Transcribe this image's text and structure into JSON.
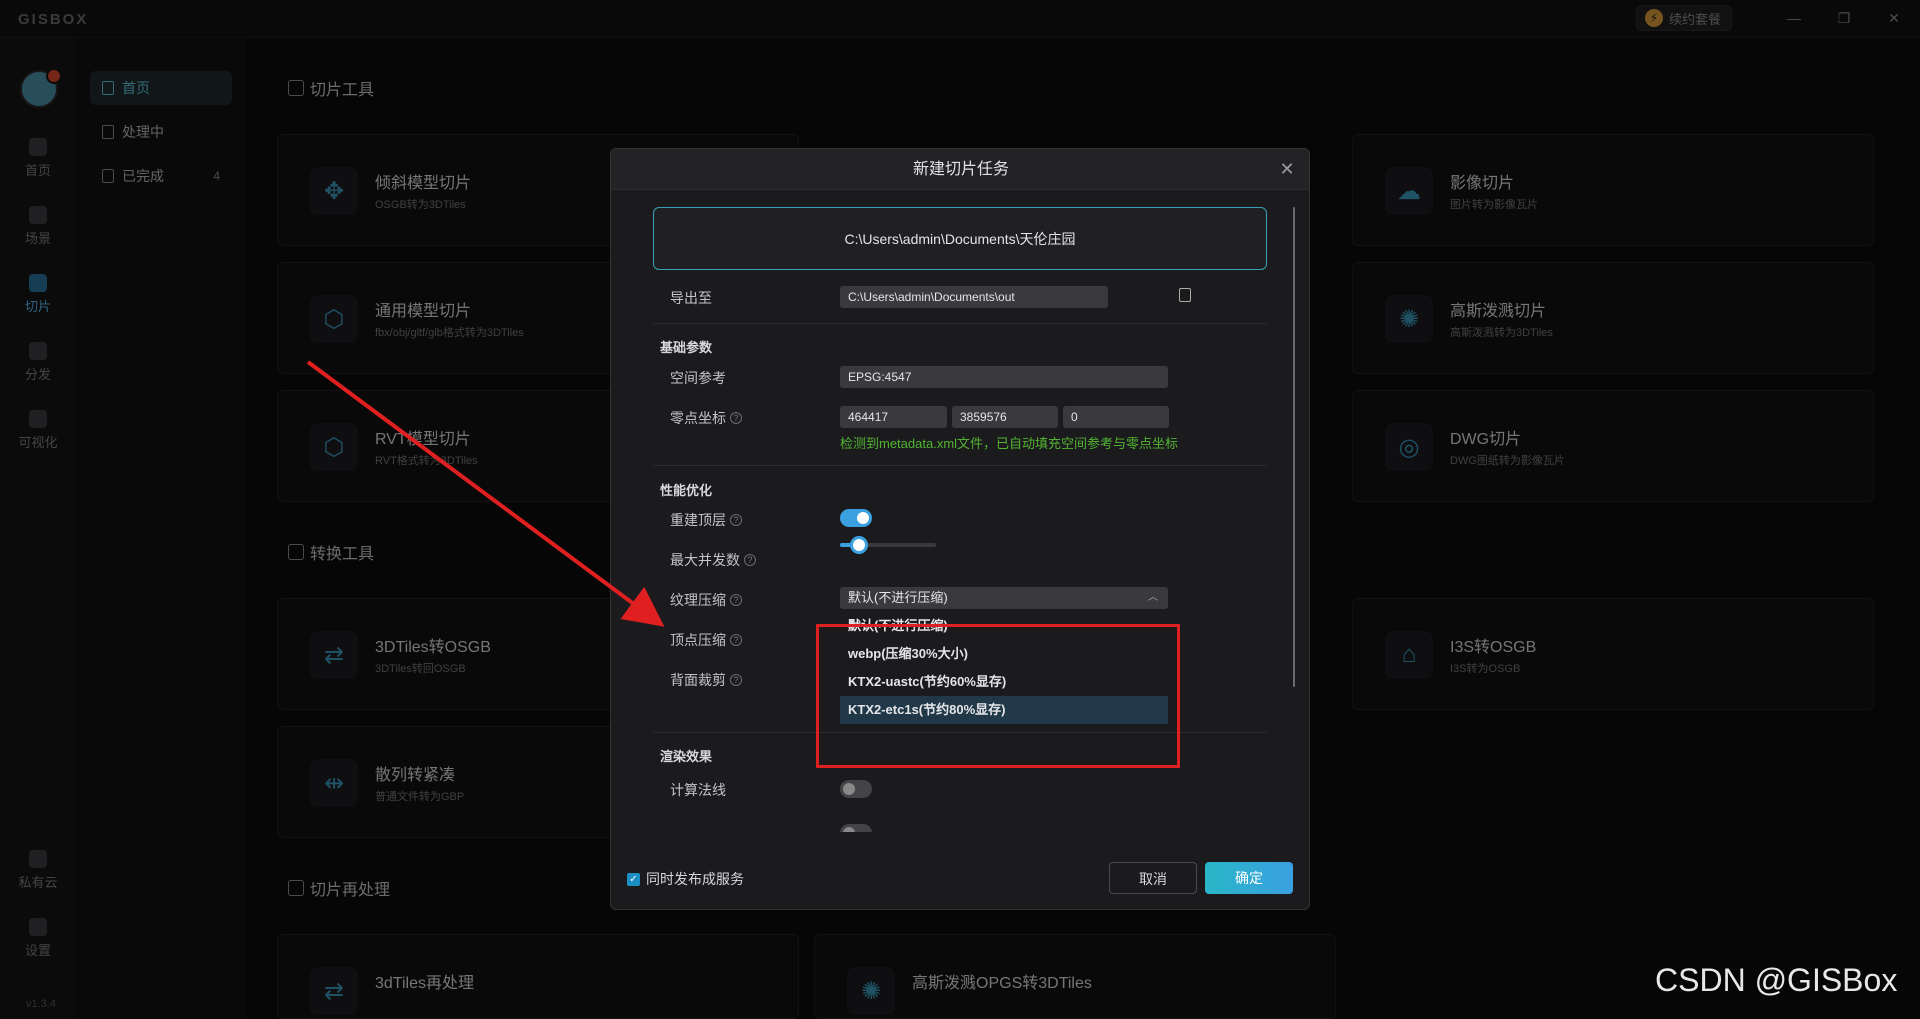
{
  "app": {
    "logo": "GISBOX",
    "renew_label": "续约套餐"
  },
  "rail": {
    "items": [
      {
        "label": "首页"
      },
      {
        "label": "场景"
      },
      {
        "label": "切片"
      },
      {
        "label": "分发"
      },
      {
        "label": "可视化"
      },
      {
        "label": "私有云"
      },
      {
        "label": "设置"
      }
    ],
    "version": "v1.3.4"
  },
  "subnav": {
    "items": [
      {
        "label": "首页"
      },
      {
        "label": "处理中"
      },
      {
        "label": "已完成",
        "count": "4"
      }
    ]
  },
  "sections": {
    "slice_tools": "切片工具",
    "convert_tools": "转换工具",
    "reprocess": "切片再处理"
  },
  "cards": [
    {
      "title": "倾斜模型切片",
      "sub": "OSGB转为3DTiles"
    },
    {
      "title": "影像切片",
      "sub": "图片转为影像瓦片"
    },
    {
      "title": "通用模型切片",
      "sub": "fbx/obj/gltf/glb格式转为3DTiles"
    },
    {
      "title": "高斯泼溅切片",
      "sub": "高斯泼溅转为3DTiles"
    },
    {
      "title": "RVT模型切片",
      "sub": "RVT格式转为3DTiles"
    },
    {
      "title": "DWG切片",
      "sub": "DWG图纸转为影像瓦片"
    },
    {
      "title": "3DTiles转OSGB",
      "sub": "3DTiles转回OSGB"
    },
    {
      "title": "I3S转OSGB",
      "sub": "I3S转为OSGB"
    },
    {
      "title": "散列转紧凑",
      "sub": "普通文件转为GBP"
    },
    {
      "title": "3dTiles再处理",
      "sub": ""
    },
    {
      "title": "高斯泼溅OPGS转3DTiles",
      "sub": ""
    }
  ],
  "dialog": {
    "title": "新建切片任务",
    "source_path": "C:\\Users\\admin\\Documents\\天伦庄园",
    "export_label": "导出至",
    "export_path": "C:\\Users\\admin\\Documents\\out",
    "basic_group": "基础参数",
    "crs_label": "空间参考",
    "crs_value": "EPSG:4547",
    "origin_label": "零点坐标",
    "origin_x": "464417",
    "origin_y": "3859576",
    "origin_z": "0",
    "hint": "检测到metadata.xml文件，已自动填充空间参考与零点坐标",
    "perf_group": "性能优化",
    "rebuild_label": "重建顶层",
    "rebuild_on": true,
    "concurrency_label": "最大并发数",
    "concurrency_level": 0.2,
    "texture_label": "纹理压缩",
    "texture_value": "默认(不进行压缩)",
    "vertex_label": "顶点压缩",
    "backface_label": "背面裁剪",
    "texture_options": [
      "默认(不进行压缩)",
      "webp(压缩30%大小)",
      "KTX2-uastc(节约60%显存)",
      "KTX2-etc1s(节约80%显存)"
    ],
    "highlighted_option": 3,
    "render_group": "渲染效果",
    "normals_label": "计算法线",
    "publish_label": "同时发布成服务",
    "cancel_label": "取消",
    "ok_label": "确定"
  },
  "watermark": "CSDN @GISBox",
  "colors": {
    "accent": "#3aa0e0",
    "hint": "#52b432",
    "highlight_box": "#e02020"
  }
}
